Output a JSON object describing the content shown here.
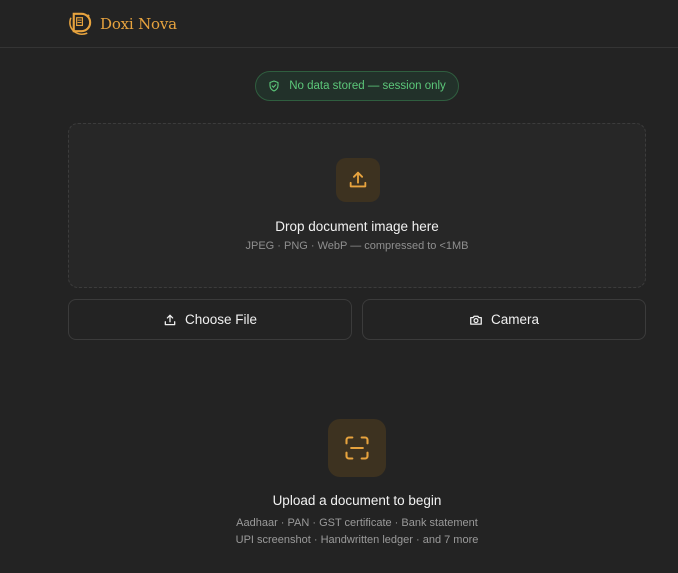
{
  "header": {
    "brand_name": "Doxi Nova",
    "logo_icon": "doxi-nova-logo"
  },
  "privacy_badge": {
    "icon": "shield-check-icon",
    "text": "No data stored — session only"
  },
  "dropzone": {
    "icon": "upload-icon",
    "title": "Drop document image here",
    "subtitle": "JPEG · PNG · WebP — compressed to <1MB"
  },
  "actions": {
    "choose_file_label": "Choose File",
    "choose_file_icon": "upload-icon",
    "camera_label": "Camera",
    "camera_icon": "camera-icon"
  },
  "empty_state": {
    "icon": "scan-icon",
    "title": "Upload a document to begin",
    "line1": "Aadhaar · PAN · GST certificate · Bank statement",
    "line2": "UPI screenshot · Handwritten ledger · and 7 more"
  },
  "colors": {
    "background": "#232323",
    "accent": "#e7a33e",
    "success": "#5cc77a",
    "icon_bg": "#3d3220"
  }
}
